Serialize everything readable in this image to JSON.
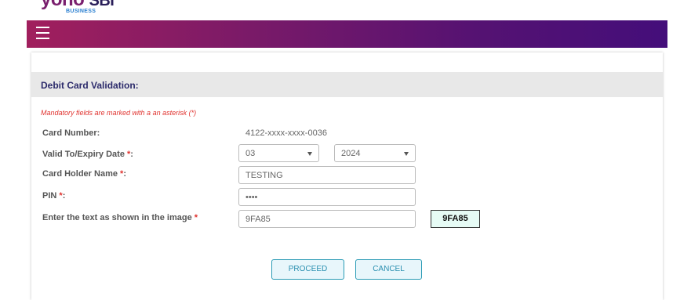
{
  "logo": {
    "main_left": "yono",
    "main_right": "SBI",
    "sub": "BUSINESS"
  },
  "header": {
    "menu_icon": "hamburger-menu-icon"
  },
  "panel": {
    "title": "Debit Card Validation:",
    "mandatory_note": "Mandatory fields are marked with a an asterisk (*)"
  },
  "form": {
    "card_number": {
      "label": "Card Number:",
      "value": "4122-xxxx-xxxx-0036"
    },
    "expiry": {
      "label": "Valid To/Expiry Date ",
      "asterisk": "*",
      "colon": ":",
      "month": "03",
      "year": "2024"
    },
    "holder_name": {
      "label": "Card Holder Name ",
      "asterisk": "*",
      "colon": ":",
      "value": "TESTING"
    },
    "pin": {
      "label": "PIN ",
      "asterisk": "*",
      "colon": ":",
      "value": "••••"
    },
    "captcha": {
      "label": "Enter the text as shown in the image ",
      "asterisk": "*",
      "value": "9FA85",
      "image_text": "9FA85"
    }
  },
  "buttons": {
    "proceed": "PROCEED",
    "cancel": "CANCEL"
  },
  "colors": {
    "brand_start": "#a11f5d",
    "brand_end": "#440e7a",
    "title": "#2b2a6b",
    "error": "#e0322e",
    "button": "#2a9bb5"
  }
}
